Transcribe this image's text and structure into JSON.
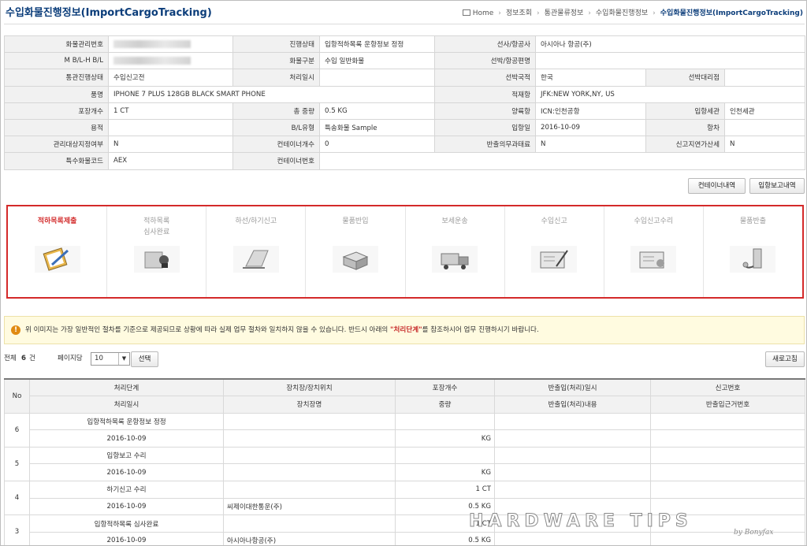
{
  "page": {
    "title": "수입화물진행정보(ImportCargoTracking)"
  },
  "breadcrumb": [
    "Home",
    "정보조회",
    "통관물류정보",
    "수입화물진행정보",
    "수입화물진행정보(ImportCargoTracking)"
  ],
  "info": {
    "r1": [
      "화물관리번호",
      "",
      "진행상태",
      "입항적하목록 운항정보 정정",
      "선사/항공사",
      "아시아나 항공(주)"
    ],
    "r2": [
      "M B/L-H B/L",
      "",
      "화물구분",
      "수입 일반화물",
      "선박/항공편명",
      ""
    ],
    "r3": [
      "통관진행상태",
      "수입신고전",
      "처리일시",
      "",
      "선박국적",
      "한국",
      "선박대리점",
      ""
    ],
    "r4": [
      "품명",
      "IPHONE 7 PLUS 128GB BLACK SMART PHONE",
      "적재항",
      "JFK:NEW YORK,NY, US"
    ],
    "r5": [
      "포장개수",
      "1 CT",
      "총 중량",
      "0.5 KG",
      "양륙항",
      "ICN:인천공항",
      "입항세관",
      "인천세관"
    ],
    "r6": [
      "용적",
      "",
      "B/L유형",
      "특송화물 Sample",
      "입항일",
      "2016-10-09",
      "항차",
      ""
    ],
    "r7": [
      "관리대상지정여부",
      "N",
      "컨테이너개수",
      "0",
      "반출의무과태료",
      "N",
      "신고지연가산세",
      "N"
    ],
    "r8": [
      "특수화물코드",
      "AEX",
      "컨테이너번호",
      ""
    ]
  },
  "buttons": {
    "container": "컨테이너내역",
    "arrival": "입항보고내역",
    "search": "선택",
    "refresh": "새로고침"
  },
  "steps": [
    {
      "label": "적하목록제출",
      "icon": "clipboard-pencil-icon",
      "active": true
    },
    {
      "label": "적하목록\n심사완료",
      "icon": "stamp-icon",
      "active": false
    },
    {
      "label": "하선/하기신고",
      "icon": "laptop-icon",
      "active": false
    },
    {
      "label": "물품반입",
      "icon": "boxes-icon",
      "active": false
    },
    {
      "label": "보세운송",
      "icon": "truck-icon",
      "active": false
    },
    {
      "label": "수입신고",
      "icon": "form-pen-icon",
      "active": false
    },
    {
      "label": "수입신고수리",
      "icon": "approved-form-icon",
      "active": false
    },
    {
      "label": "물품반출",
      "icon": "exit-icon",
      "active": false
    }
  ],
  "notice": {
    "pre": "위 이미지는 가장 일반적인 절차를 기준으로 제공되므로 상황에 따라 실제 업무 절차와 일치하지 않을 수 있습니다. 반드시 아래의 ",
    "highlight": "\"처리단계\"",
    "post": "를 참조하시어 업무 진행하시기 바랍니다."
  },
  "list": {
    "total_label": "전체",
    "total": "6",
    "unit": "건",
    "per_page_label": "페이지당",
    "per_page": "10"
  },
  "columns": {
    "no": "No",
    "h1": [
      "처리단계",
      "장치장/장치위치",
      "포장개수",
      "반출입(처리)일시",
      "신고번호"
    ],
    "h2": [
      "처리일시",
      "장치장명",
      "중량",
      "반출입(처리)내용",
      "반출입근거번호"
    ]
  },
  "rows": [
    {
      "no": "6",
      "step": "입항적하목록 운항정보 정정",
      "date": "2016-10-09",
      "place": "",
      "count": "",
      "weight": "KG"
    },
    {
      "no": "5",
      "step": "입항보고 수리",
      "date": "2016-10-09",
      "place": "",
      "count": "",
      "weight": "KG"
    },
    {
      "no": "4",
      "step": "하기신고 수리",
      "date": "2016-10-09",
      "place": "씨제이대한통운(주)",
      "count": "1 CT",
      "weight": "0.5 KG"
    },
    {
      "no": "3",
      "step": "입항적하목록 심사완료",
      "date": "2016-10-09",
      "place": "아시아나항공(주)",
      "count": "1 CT",
      "weight": "0.5 KG"
    }
  ],
  "watermark": {
    "text": "HARDWARE TIPS",
    "sub": "by Bonyfax"
  }
}
